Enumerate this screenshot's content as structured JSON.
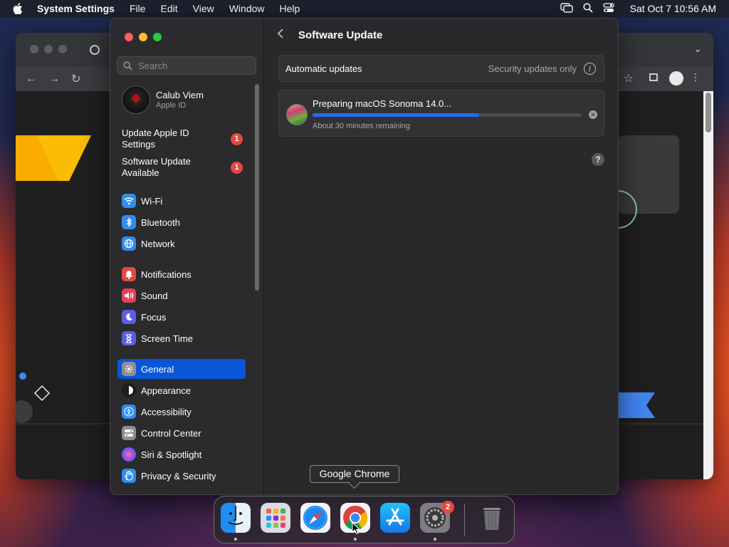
{
  "menubar": {
    "app_name": "System Settings",
    "items": [
      "File",
      "Edit",
      "View",
      "Window",
      "Help"
    ],
    "clock": "Sat Oct 7  10:56 AM"
  },
  "sidebar": {
    "search_placeholder": "Search",
    "profile": {
      "name": "Calub Viem",
      "subtitle": "Apple ID"
    },
    "notices": [
      {
        "label": "Update Apple ID Settings",
        "badge": "1"
      },
      {
        "label": "Software Update Available",
        "badge": "1"
      }
    ],
    "items": [
      {
        "label": "Wi-Fi",
        "icon": "wifi-icon",
        "color": "#2f8cf0"
      },
      {
        "label": "Bluetooth",
        "icon": "bluetooth-icon",
        "color": "#2f8cf0"
      },
      {
        "label": "Network",
        "icon": "globe-icon",
        "color": "#2f8cf0"
      },
      {
        "label": "Notifications",
        "icon": "bell-icon",
        "color": "#e5483f"
      },
      {
        "label": "Sound",
        "icon": "speaker-icon",
        "color": "#e5405e"
      },
      {
        "label": "Focus",
        "icon": "moon-icon",
        "color": "#5e5ce6"
      },
      {
        "label": "Screen Time",
        "icon": "hourglass-icon",
        "color": "#5e5ce6"
      },
      {
        "label": "General",
        "icon": "gear-icon",
        "color": "#8e8e93",
        "active": true
      },
      {
        "label": "Appearance",
        "icon": "appearance-icon",
        "color": "#1c1c1e"
      },
      {
        "label": "Accessibility",
        "icon": "accessibility-icon",
        "color": "#2f8cf0"
      },
      {
        "label": "Control Center",
        "icon": "toggles-icon",
        "color": "#8e8e93"
      },
      {
        "label": "Siri & Spotlight",
        "icon": "siri-icon",
        "color": "#b04fd8"
      },
      {
        "label": "Privacy & Security",
        "icon": "hand-icon",
        "color": "#2f8cf0"
      }
    ]
  },
  "main": {
    "title": "Software Update",
    "automatic": {
      "label": "Automatic updates",
      "value": "Security updates only"
    },
    "update": {
      "title": "Preparing macOS Sonoma 14.0...",
      "remaining": "About 30 minutes remaining",
      "progress": 0.62
    },
    "help": "?"
  },
  "tooltip": "Google Chrome",
  "dock": {
    "apps": [
      "Finder",
      "Launchpad",
      "Safari",
      "Google Chrome",
      "App Store",
      "System Settings",
      "Trash"
    ],
    "settings_badge": "2"
  }
}
